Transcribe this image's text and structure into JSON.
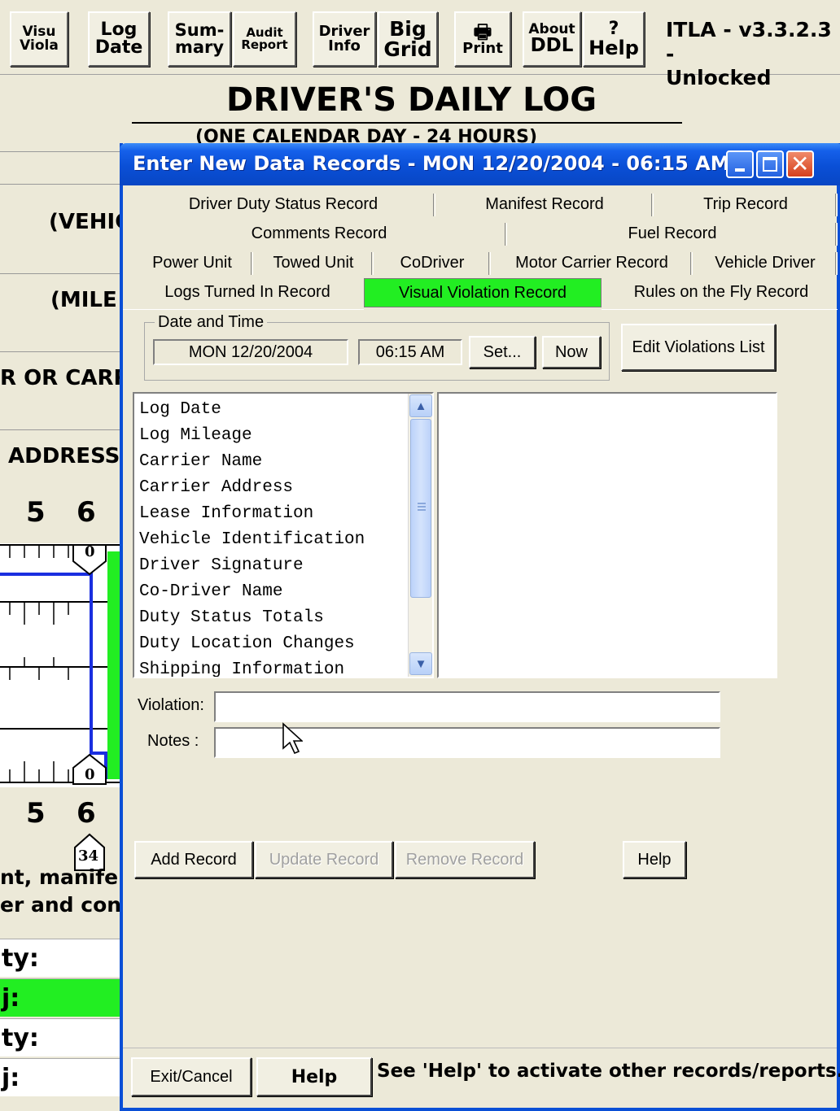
{
  "toolbar": {
    "buttons": [
      {
        "line1": "Visu",
        "line2": "Viola"
      },
      {
        "line1": "Log",
        "line2": "Date"
      },
      {
        "line1": "Sum-",
        "line2": "mary"
      },
      {
        "line1": "Audit",
        "line2": "Report"
      },
      {
        "line1": "Driver",
        "line2": "Info"
      },
      {
        "line1": "Big",
        "line2": "Grid"
      },
      {
        "line1": "🖶",
        "line2": "Print"
      },
      {
        "line1": "About",
        "line2": "DDL"
      },
      {
        "line1": "?",
        "line2": "Help"
      }
    ],
    "version_line1": "ITLA - v3.3.2.3 -",
    "version_line2": "Unlocked"
  },
  "background": {
    "title": "DRIVER'S DAILY LOG",
    "subtitle": "(ONE CALENDAR DAY - 24 HOURS)",
    "labels": [
      "(VEHIC",
      "(MILE",
      "R OR CARR",
      "ADDRESS"
    ],
    "hour_top": [
      "5",
      "6"
    ],
    "hour_bottom": [
      "5",
      "6"
    ],
    "marker_top": "0",
    "marker_bottom": "0",
    "marker_odometer": "34",
    "remark_lines": [
      "nt, manife",
      "er and con"
    ],
    "bottom_rows": [
      "ty:",
      "j:",
      "ty:",
      "j:"
    ]
  },
  "dialog": {
    "title": "Enter New Data Records - MON 12/20/2004  - 06:15 AM",
    "tabs": {
      "row1": [
        "Driver Duty Status Record",
        "Manifest Record",
        "Trip Record"
      ],
      "row2": [
        "Comments Record",
        "Fuel Record"
      ],
      "row3": [
        "Power Unit",
        "Towed Unit",
        "CoDriver",
        "Motor Carrier Record",
        "Vehicle Driver"
      ],
      "row4": [
        "Logs Turned In Record",
        "Visual Violation Record",
        "Rules on the Fly Record"
      ]
    },
    "date_time": {
      "legend": "Date and Time",
      "date": "MON 12/20/2004",
      "time": "06:15 AM",
      "set_label": "Set...",
      "now_label": "Now"
    },
    "edit_violations_label": "Edit Violations List",
    "violation_list": [
      "Log Date",
      "Log Mileage",
      "Carrier Name",
      "Carrier Address",
      "Lease Information",
      "Vehicle Identification",
      "Driver Signature",
      "Co-Driver Name",
      "Duty Status Totals",
      "Duty Location Changes",
      "Shipping Information"
    ],
    "violation_label": "Violation:",
    "violation_value": "",
    "notes_label": "Notes :",
    "notes_value": "",
    "buttons": {
      "add": "Add Record",
      "update": "Update Record",
      "remove": "Remove Record",
      "help": "Help"
    },
    "footer": {
      "exit": "Exit/Cancel",
      "help": "Help",
      "status": "See 'Help' to activate other records/reports."
    }
  },
  "colors": {
    "active_tab": "#22ee22",
    "titlebar": "#0a4fd6",
    "grid_line": "#1a2ee0"
  }
}
